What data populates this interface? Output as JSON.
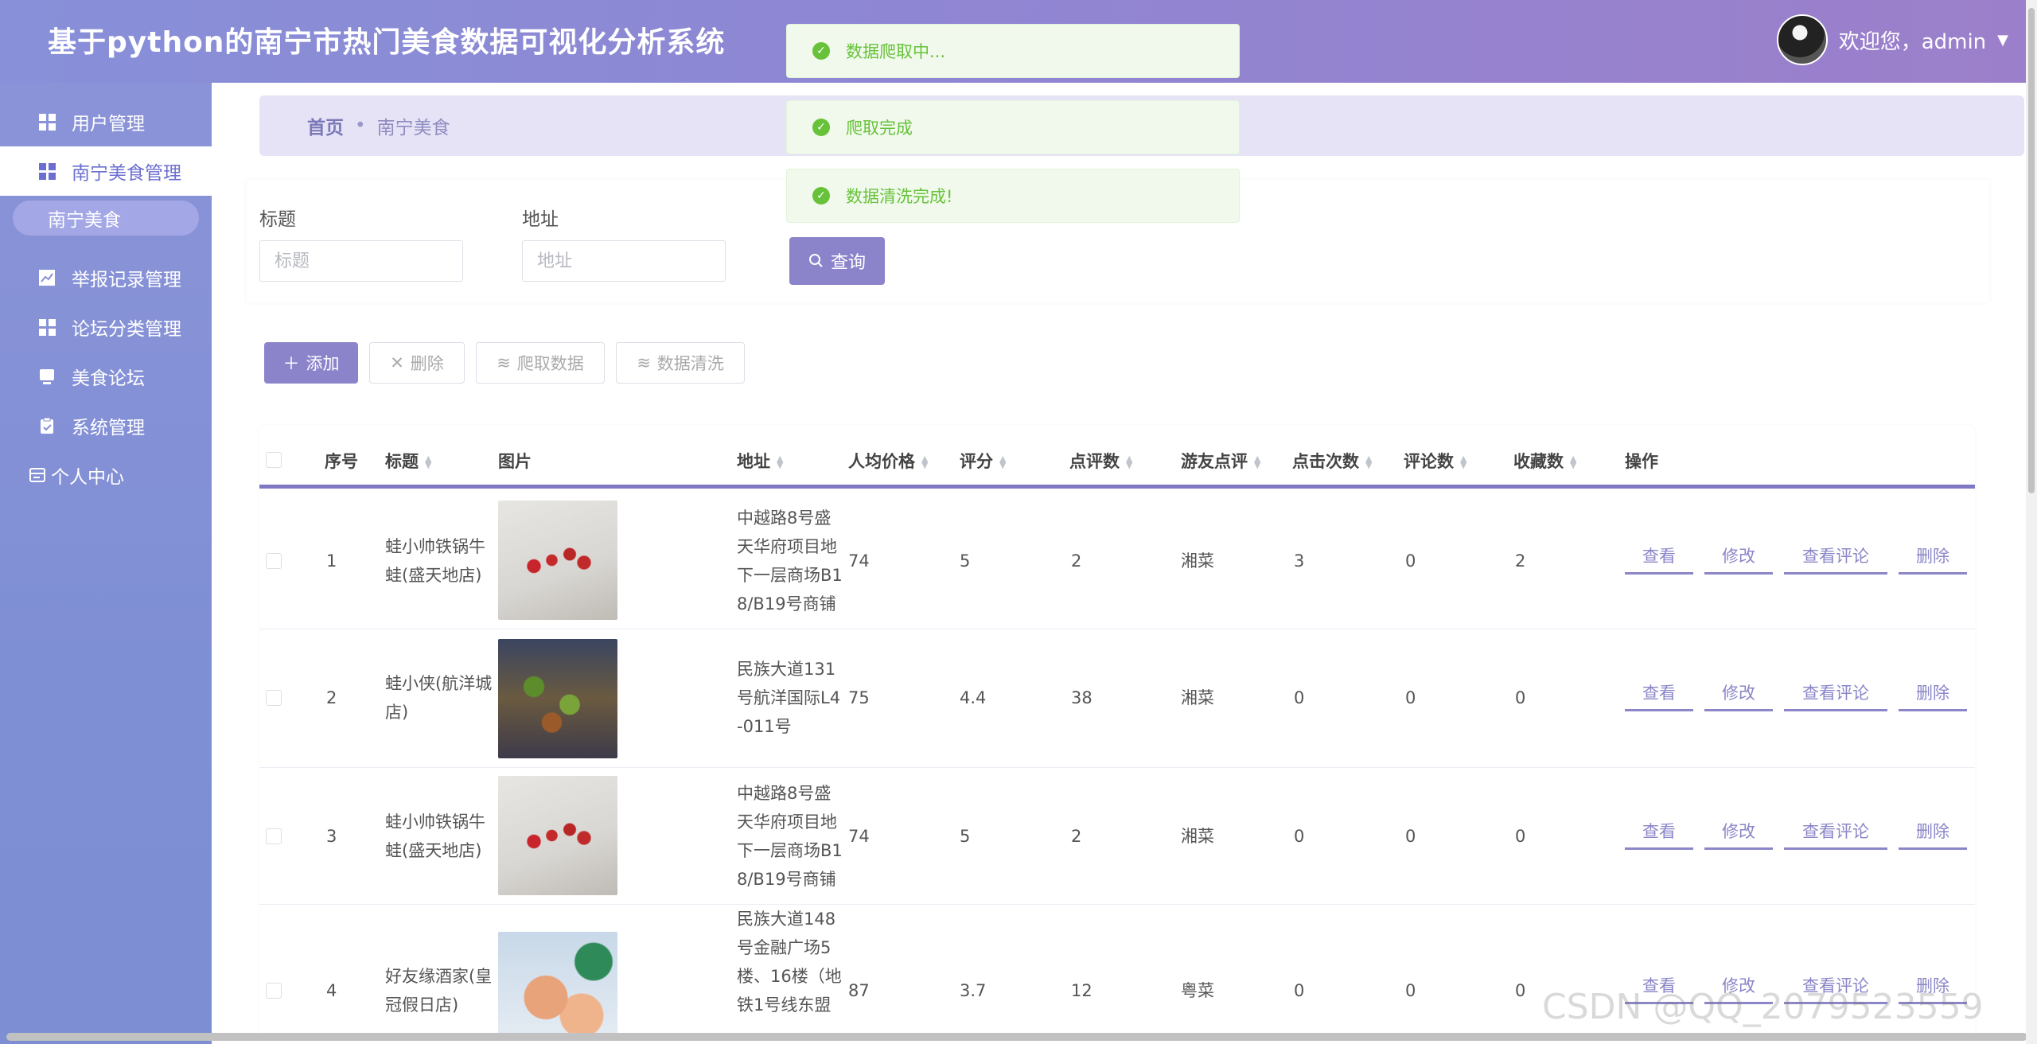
{
  "app": {
    "title": "基于python的南宁市热门美食数据可视化分析系统",
    "welcome": "欢迎您，admin"
  },
  "sidebar": {
    "items": [
      {
        "label": "用户管理",
        "icon": "grid-icon"
      },
      {
        "label": "南宁美食管理",
        "icon": "grid-icon"
      },
      {
        "label": "南宁美食",
        "icon": ""
      },
      {
        "label": "举报记录管理",
        "icon": "chart-icon"
      },
      {
        "label": "论坛分类管理",
        "icon": "grid-icon"
      },
      {
        "label": "美食论坛",
        "icon": "monitor-icon"
      },
      {
        "label": "系统管理",
        "icon": "clipboard-icon"
      },
      {
        "label": "个人中心",
        "icon": "card-icon"
      }
    ]
  },
  "breadcrumb": {
    "home": "首页",
    "separator": "•",
    "current": "南宁美食"
  },
  "toasts": [
    "数据爬取中...",
    "爬取完成",
    "数据清洗完成!"
  ],
  "search": {
    "title_label": "标题",
    "title_placeholder": "标题",
    "address_label": "地址",
    "address_placeholder": "地址",
    "query_button": "查询"
  },
  "actions": {
    "add": "添加",
    "delete": "删除",
    "crawl": "爬取数据",
    "clean": "数据清洗"
  },
  "table": {
    "headers": [
      "序号",
      "标题",
      "图片",
      "地址",
      "人均价格",
      "评分",
      "点评数",
      "游友点评",
      "点击次数",
      "评论数",
      "收藏数",
      "操作"
    ],
    "ops": [
      "查看",
      "修改",
      "查看评论",
      "删除"
    ],
    "rows": [
      {
        "index": "1",
        "title": "蛙小帅铁锅牛蛙(盛天地店)",
        "image": "thumb-a",
        "address": "中越路8号盛天华府项目地下一层商场B18/B19号商铺",
        "price": "74",
        "score": "5",
        "reviews": "2",
        "cuisine": "湘菜",
        "clicks": "3",
        "comments": "0",
        "favorites": "2"
      },
      {
        "index": "2",
        "title": "蛙小侠(航洋城店)",
        "image": "thumb-b",
        "address": "民族大道131号航洋国际L4-011号",
        "price": "75",
        "score": "4.4",
        "reviews": "38",
        "cuisine": "湘菜",
        "clicks": "0",
        "comments": "0",
        "favorites": "0"
      },
      {
        "index": "3",
        "title": "蛙小帅铁锅牛蛙(盛天地店)",
        "image": "thumb-a",
        "address": "中越路8号盛天华府项目地下一层商场B18/B19号商铺",
        "price": "74",
        "score": "5",
        "reviews": "2",
        "cuisine": "湘菜",
        "clicks": "0",
        "comments": "0",
        "favorites": "0"
      },
      {
        "index": "4",
        "title": "好友缘酒家(皇冠假日店)",
        "image": "thumb-c",
        "address": "民族大道148号金融广场5楼、16楼（地铁1号线东盟",
        "price": "87",
        "score": "3.7",
        "reviews": "12",
        "cuisine": "粤菜",
        "clicks": "0",
        "comments": "0",
        "favorites": "0"
      }
    ]
  },
  "watermark": "CSDN @QQ_2079523559"
}
